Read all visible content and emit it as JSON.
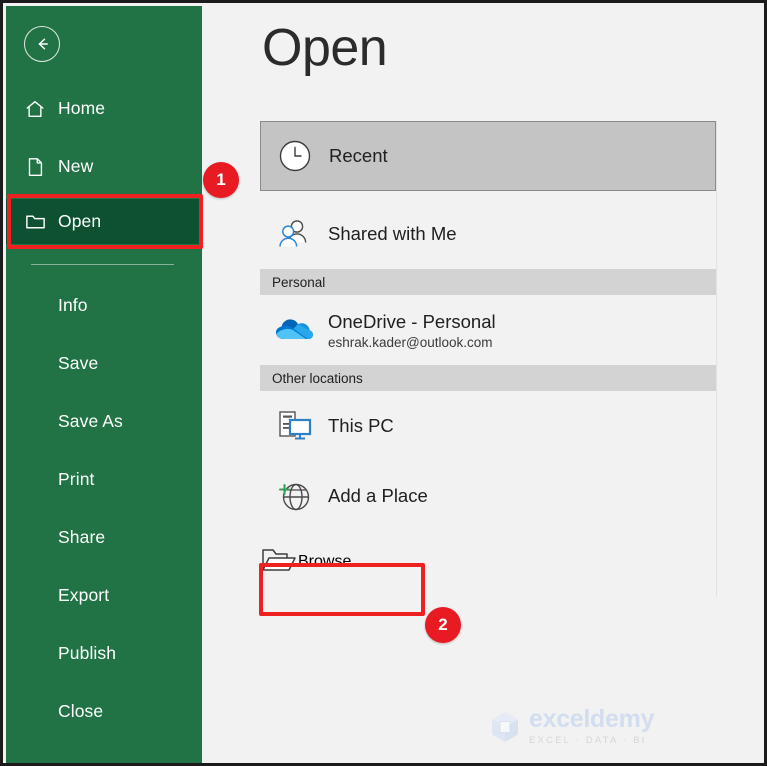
{
  "app": {
    "accent_green": "#217346",
    "selected_green": "#0d5130",
    "annotation_red": "#ef2020",
    "badge_red": "#e81b22"
  },
  "sidebar": {
    "back_label": "Back",
    "items": [
      {
        "label": "Home",
        "icon": "home-icon",
        "selected": false
      },
      {
        "label": "New",
        "icon": "page-icon",
        "selected": false
      },
      {
        "label": "Open",
        "icon": "folder-icon",
        "selected": true
      },
      {
        "label": "Info",
        "icon": "",
        "selected": false
      },
      {
        "label": "Save",
        "icon": "",
        "selected": false
      },
      {
        "label": "Save As",
        "icon": "",
        "selected": false
      },
      {
        "label": "Print",
        "icon": "",
        "selected": false
      },
      {
        "label": "Share",
        "icon": "",
        "selected": false
      },
      {
        "label": "Export",
        "icon": "",
        "selected": false
      },
      {
        "label": "Publish",
        "icon": "",
        "selected": false
      },
      {
        "label": "Close",
        "icon": "",
        "selected": false
      }
    ]
  },
  "main": {
    "title": "Open",
    "recent": {
      "label": "Recent",
      "icon": "clock-icon"
    },
    "shared": {
      "label": "Shared with Me",
      "icon": "people-icon"
    },
    "personal_header": "Personal",
    "onedrive": {
      "title": "OneDrive - Personal",
      "subtitle": "eshrak.kader@outlook.com",
      "icon": "onedrive-cloud-icon"
    },
    "other_header": "Other locations",
    "this_pc": {
      "label": "This PC",
      "icon": "computer-icon"
    },
    "add_place": {
      "label": "Add a Place",
      "icon": "globe-plus-icon"
    },
    "browse": {
      "label": "Browse",
      "icon": "open-folder-icon"
    }
  },
  "annotations": {
    "badge_one": "1",
    "badge_two": "2"
  },
  "watermark": {
    "name": "exceldemy",
    "tagline": "EXCEL · DATA · BI"
  }
}
